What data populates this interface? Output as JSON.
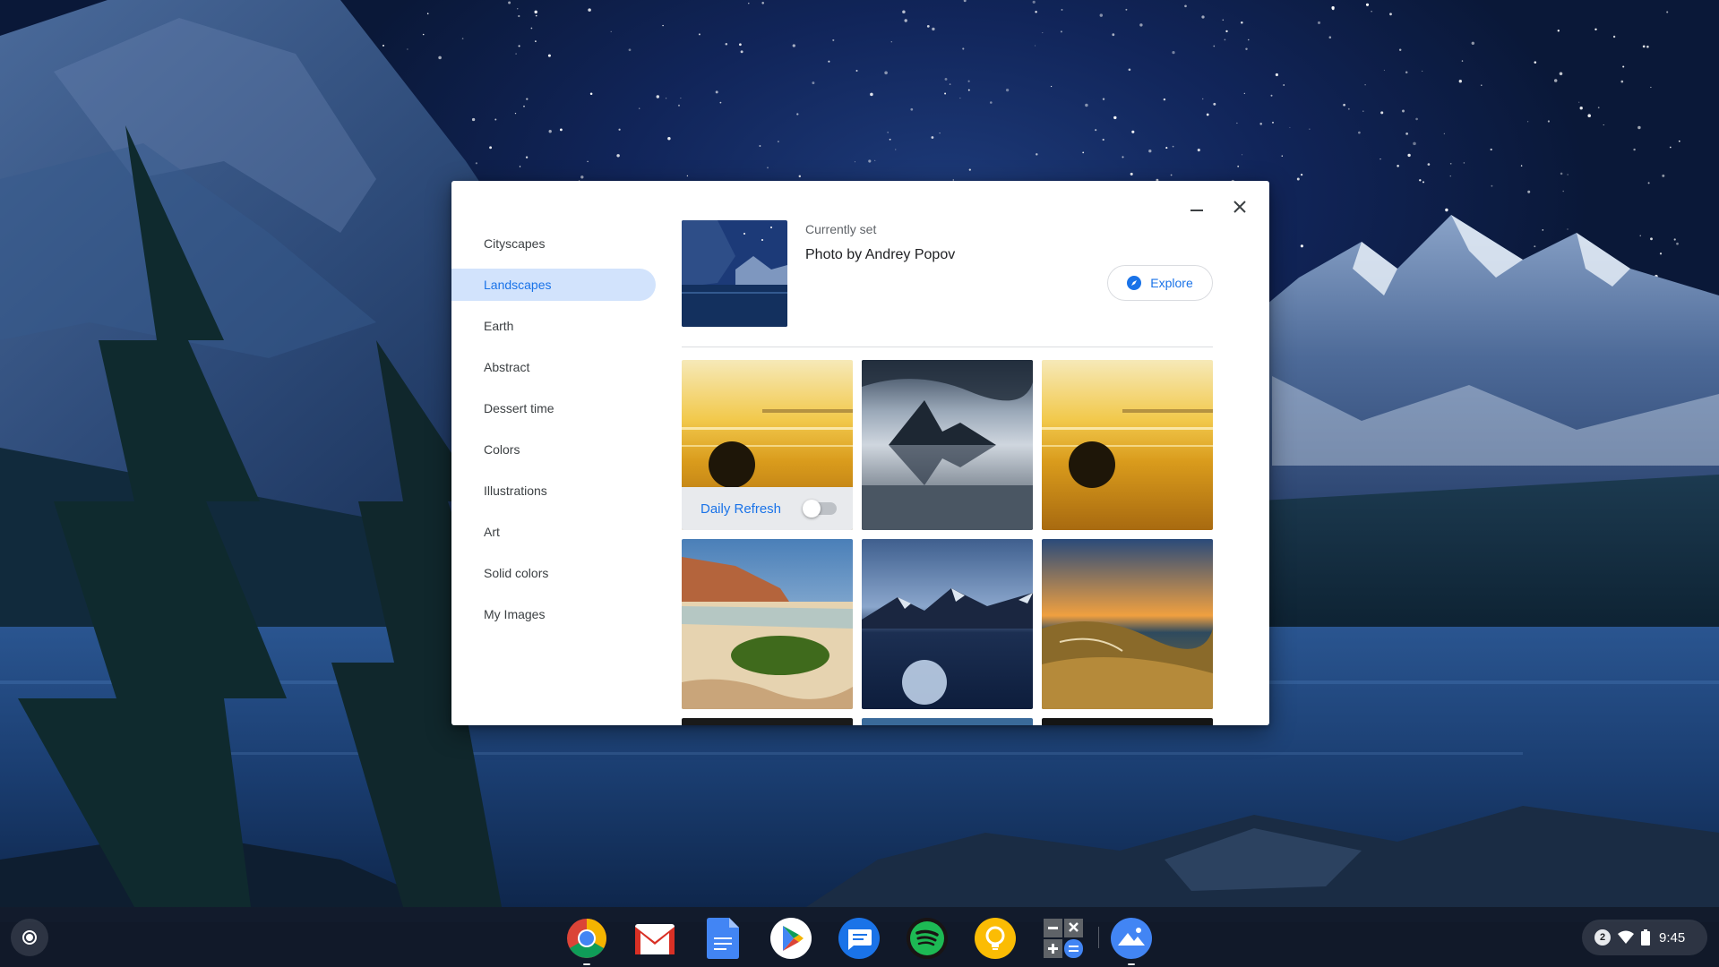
{
  "window": {
    "minimize_icon": "minimize-icon",
    "close_icon": "close-icon"
  },
  "sidebar": {
    "items": [
      {
        "label": "Cityscapes",
        "active": false
      },
      {
        "label": "Landscapes",
        "active": true
      },
      {
        "label": "Earth",
        "active": false
      },
      {
        "label": "Abstract",
        "active": false
      },
      {
        "label": "Dessert time",
        "active": false
      },
      {
        "label": "Colors",
        "active": false
      },
      {
        "label": "Illustrations",
        "active": false
      },
      {
        "label": "Art",
        "active": false
      },
      {
        "label": "Solid colors",
        "active": false
      },
      {
        "label": "My Images",
        "active": false
      }
    ]
  },
  "current": {
    "label": "Currently set",
    "title": "Photo by Andrey Popov",
    "explore_label": "Explore",
    "explore_icon": "compass-icon"
  },
  "grid": {
    "daily_refresh_label": "Daily Refresh",
    "daily_refresh_on": false,
    "tiles": [
      {
        "name": "wallpaper-golden-beach-orb",
        "theme": "golden-beach"
      },
      {
        "name": "wallpaper-misty-fjord",
        "theme": "misty-fjord"
      },
      {
        "name": "wallpaper-golden-beach-orb-2",
        "theme": "golden-beach"
      },
      {
        "name": "wallpaper-mossy-rock-beach",
        "theme": "mossy-rock"
      },
      {
        "name": "wallpaper-blue-lake-mountains",
        "theme": "blue-lake"
      },
      {
        "name": "wallpaper-sunset-hills",
        "theme": "sunset-hills"
      }
    ]
  },
  "shelf": {
    "apps": [
      {
        "name": "chrome",
        "icon": "chrome-icon",
        "running": true
      },
      {
        "name": "gmail",
        "icon": "gmail-icon",
        "running": false
      },
      {
        "name": "docs",
        "icon": "docs-icon",
        "running": false
      },
      {
        "name": "play-store",
        "icon": "play-store-icon",
        "running": false
      },
      {
        "name": "messages",
        "icon": "messages-icon",
        "running": false
      },
      {
        "name": "spotify",
        "icon": "spotify-icon",
        "running": false
      },
      {
        "name": "keep",
        "icon": "keep-icon",
        "running": false
      },
      {
        "name": "calculator",
        "icon": "calculator-icon",
        "running": false
      },
      {
        "name": "wallpaper-picker",
        "icon": "wallpaper-app-icon",
        "running": true
      }
    ],
    "tray": {
      "notification_count": "2",
      "time": "9:45"
    }
  },
  "colors": {
    "accent": "#1a73e8",
    "active_bg": "#d2e3fc"
  }
}
